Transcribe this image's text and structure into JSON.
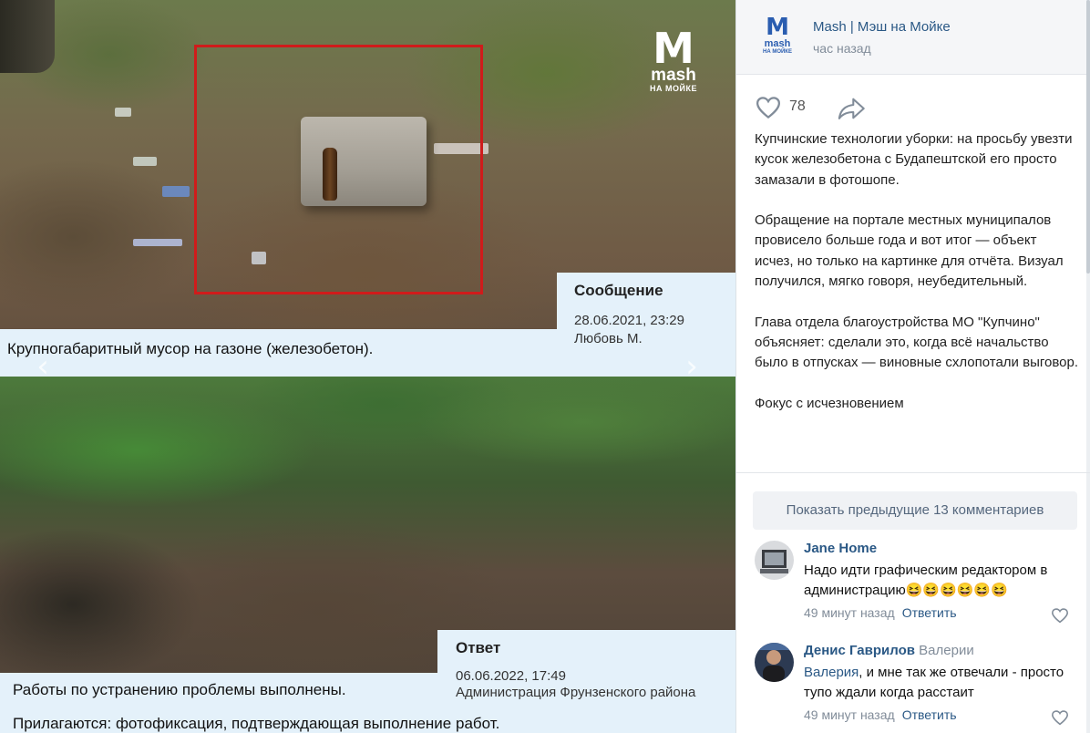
{
  "viewer": {
    "watermark": {
      "letter": "M",
      "word": "mash",
      "sub": "НА МОЙКЕ"
    },
    "top_caption": "Крупногабаритный мусор на газоне (железобетон).",
    "message_box": {
      "title": "Сообщение",
      "datetime": "28.06.2021, 23:29",
      "author": "Любовь М."
    },
    "prev_arrow": "‹",
    "next_arrow": "›",
    "answer_box": {
      "title": "Ответ",
      "datetime": "06.06.2022, 17:49",
      "author": "Администрация Фрунзенского района"
    },
    "answer_line1": "Работы по устранению проблемы выполнены.",
    "answer_line2": "Прилагаются: фотофиксация, подтверждающая выполнение работ."
  },
  "post": {
    "avatar": {
      "letter": "M",
      "word": "mash",
      "sub": "НА МОЙКЕ"
    },
    "group_name": "Mash | Мэш на Мойке",
    "time": "час назад",
    "likes": "78",
    "paragraphs": [
      "Купчинские технологии уборки: на просьбу увезти кусок железобетона с Будапештской его просто замазали в фотошопе.",
      "Обращение на портале местных муниципалов провисело больше года и вот итог — объект исчез, но только на картинке для отчёта. Визуал получился, мягко говоря, неубедительный.",
      "Глава отдела благоустройства МО \"Купчино\" объясняет: сделали это, когда всё начальство было в отпусках — виновные схлопотали выговор.",
      "Фокус с исчезновением"
    ]
  },
  "comments": {
    "show_previous": "Показать предыдущие 13 комментариев",
    "items": [
      {
        "author": "Jane Home",
        "text": "Надо идти графическим редактором в администрацию😆😆😆😆😆😆",
        "time": "49 минут назад",
        "reply_label": "Ответить"
      },
      {
        "author": "Денис Гаврилов",
        "reply_to": "Валерии",
        "addressee": "Валерия",
        "text": ", и мне так же отвечали - просто тупо ждали когда расстаит",
        "time": "49 минут назад",
        "reply_label": "Ответить"
      }
    ]
  },
  "colors": {
    "link": "#2a5885",
    "caption_bg": "#e4f1fa",
    "frame_red": "#d01b1b",
    "meta_gray": "#818c99"
  },
  "icons": [
    "heart-icon",
    "share-icon",
    "chevron-left-icon",
    "chevron-right-icon"
  ]
}
